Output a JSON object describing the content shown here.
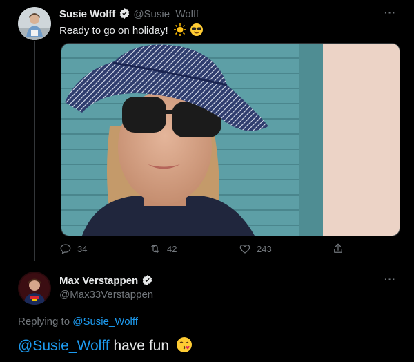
{
  "tweet1": {
    "display_name": "Susie Wolff",
    "handle": "@Susie_Wolff",
    "text": "Ready to go on holiday!",
    "emojis": [
      "sun-emoji",
      "sunglasses-emoji"
    ],
    "stats": {
      "replies": "34",
      "retweets": "42",
      "likes": "243"
    },
    "more": "···"
  },
  "tweet2": {
    "display_name": "Max Verstappen",
    "handle": "@Max33Verstappen",
    "replying_to_prefix": "Replying to",
    "replying_to_handle": "@Susie_Wolff",
    "mention": "@Susie_Wolff",
    "text_rest": " have fun",
    "emoji": "kissing-face-emoji",
    "more": "···"
  },
  "colors": {
    "background": "#000000",
    "text": "#e7e9ea",
    "secondary": "#71767b",
    "accent": "#1d9bf0"
  }
}
